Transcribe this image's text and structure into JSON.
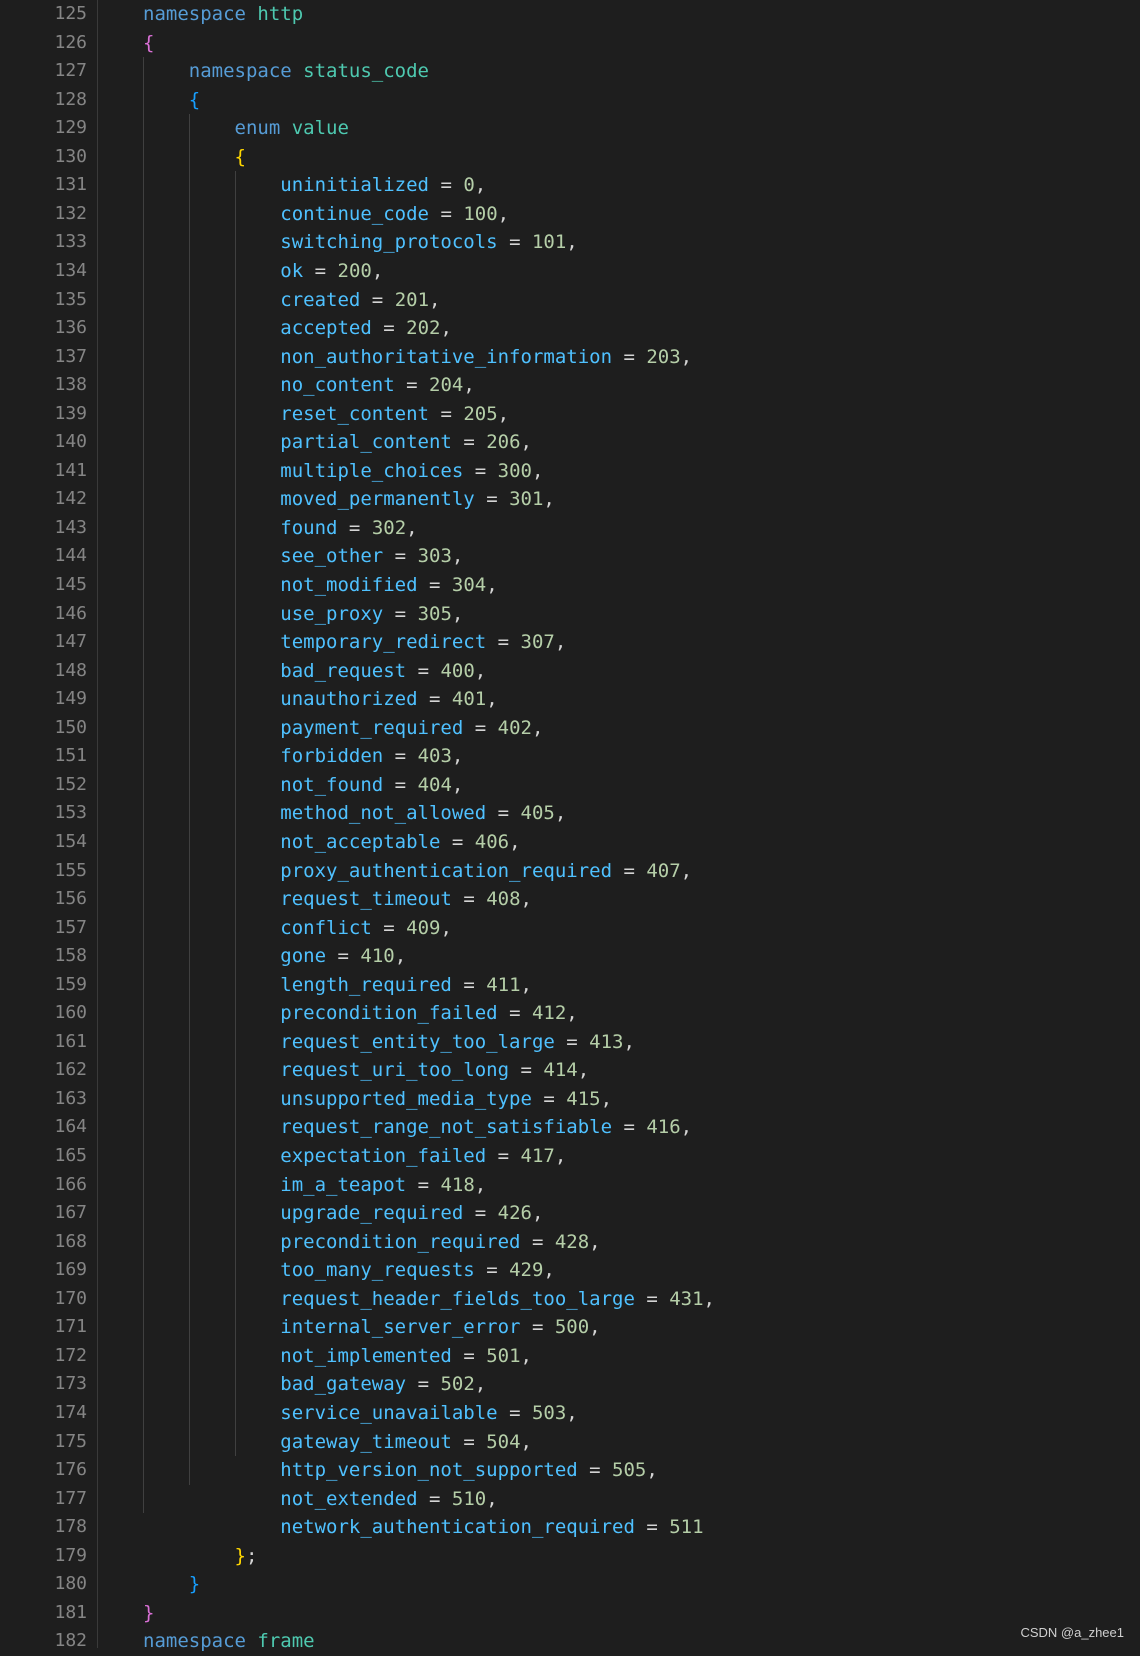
{
  "editor": {
    "first_line_number": 125,
    "lines": [
      [
        [
          "keyword",
          "namespace"
        ],
        [
          "punc",
          " "
        ],
        [
          "ns",
          "http"
        ]
      ],
      [
        [
          "brace-1",
          "{"
        ]
      ],
      [
        [
          "punc",
          "    "
        ],
        [
          "keyword",
          "namespace"
        ],
        [
          "punc",
          " "
        ],
        [
          "ns",
          "status_code"
        ]
      ],
      [
        [
          "punc",
          "    "
        ],
        [
          "brace-2",
          "{"
        ]
      ],
      [
        [
          "punc",
          "        "
        ],
        [
          "keyword",
          "enum"
        ],
        [
          "punc",
          " "
        ],
        [
          "ns",
          "value"
        ]
      ],
      [
        [
          "punc",
          "        "
        ],
        [
          "brace-3",
          "{"
        ]
      ],
      [
        [
          "punc",
          "            "
        ],
        [
          "member",
          "uninitialized"
        ],
        [
          "punc",
          " = "
        ],
        [
          "num",
          "0"
        ],
        [
          "punc",
          ","
        ]
      ],
      [
        [
          "punc",
          "            "
        ],
        [
          "member",
          "continue_code"
        ],
        [
          "punc",
          " = "
        ],
        [
          "num",
          "100"
        ],
        [
          "punc",
          ","
        ]
      ],
      [
        [
          "punc",
          "            "
        ],
        [
          "member",
          "switching_protocols"
        ],
        [
          "punc",
          " = "
        ],
        [
          "num",
          "101"
        ],
        [
          "punc",
          ","
        ]
      ],
      [
        [
          "punc",
          "            "
        ],
        [
          "member",
          "ok"
        ],
        [
          "punc",
          " = "
        ],
        [
          "num",
          "200"
        ],
        [
          "punc",
          ","
        ]
      ],
      [
        [
          "punc",
          "            "
        ],
        [
          "member",
          "created"
        ],
        [
          "punc",
          " = "
        ],
        [
          "num",
          "201"
        ],
        [
          "punc",
          ","
        ]
      ],
      [
        [
          "punc",
          "            "
        ],
        [
          "member",
          "accepted"
        ],
        [
          "punc",
          " = "
        ],
        [
          "num",
          "202"
        ],
        [
          "punc",
          ","
        ]
      ],
      [
        [
          "punc",
          "            "
        ],
        [
          "member",
          "non_authoritative_information"
        ],
        [
          "punc",
          " = "
        ],
        [
          "num",
          "203"
        ],
        [
          "punc",
          ","
        ]
      ],
      [
        [
          "punc",
          "            "
        ],
        [
          "member",
          "no_content"
        ],
        [
          "punc",
          " = "
        ],
        [
          "num",
          "204"
        ],
        [
          "punc",
          ","
        ]
      ],
      [
        [
          "punc",
          "            "
        ],
        [
          "member",
          "reset_content"
        ],
        [
          "punc",
          " = "
        ],
        [
          "num",
          "205"
        ],
        [
          "punc",
          ","
        ]
      ],
      [
        [
          "punc",
          "            "
        ],
        [
          "member",
          "partial_content"
        ],
        [
          "punc",
          " = "
        ],
        [
          "num",
          "206"
        ],
        [
          "punc",
          ","
        ]
      ],
      [
        [
          "punc",
          "            "
        ],
        [
          "member",
          "multiple_choices"
        ],
        [
          "punc",
          " = "
        ],
        [
          "num",
          "300"
        ],
        [
          "punc",
          ","
        ]
      ],
      [
        [
          "punc",
          "            "
        ],
        [
          "member",
          "moved_permanently"
        ],
        [
          "punc",
          " = "
        ],
        [
          "num",
          "301"
        ],
        [
          "punc",
          ","
        ]
      ],
      [
        [
          "punc",
          "            "
        ],
        [
          "member",
          "found"
        ],
        [
          "punc",
          " = "
        ],
        [
          "num",
          "302"
        ],
        [
          "punc",
          ","
        ]
      ],
      [
        [
          "punc",
          "            "
        ],
        [
          "member",
          "see_other"
        ],
        [
          "punc",
          " = "
        ],
        [
          "num",
          "303"
        ],
        [
          "punc",
          ","
        ]
      ],
      [
        [
          "punc",
          "            "
        ],
        [
          "member",
          "not_modified"
        ],
        [
          "punc",
          " = "
        ],
        [
          "num",
          "304"
        ],
        [
          "punc",
          ","
        ]
      ],
      [
        [
          "punc",
          "            "
        ],
        [
          "member",
          "use_proxy"
        ],
        [
          "punc",
          " = "
        ],
        [
          "num",
          "305"
        ],
        [
          "punc",
          ","
        ]
      ],
      [
        [
          "punc",
          "            "
        ],
        [
          "member",
          "temporary_redirect"
        ],
        [
          "punc",
          " = "
        ],
        [
          "num",
          "307"
        ],
        [
          "punc",
          ","
        ]
      ],
      [
        [
          "punc",
          "            "
        ],
        [
          "member",
          "bad_request"
        ],
        [
          "punc",
          " = "
        ],
        [
          "num",
          "400"
        ],
        [
          "punc",
          ","
        ]
      ],
      [
        [
          "punc",
          "            "
        ],
        [
          "member",
          "unauthorized"
        ],
        [
          "punc",
          " = "
        ],
        [
          "num",
          "401"
        ],
        [
          "punc",
          ","
        ]
      ],
      [
        [
          "punc",
          "            "
        ],
        [
          "member",
          "payment_required"
        ],
        [
          "punc",
          " = "
        ],
        [
          "num",
          "402"
        ],
        [
          "punc",
          ","
        ]
      ],
      [
        [
          "punc",
          "            "
        ],
        [
          "member",
          "forbidden"
        ],
        [
          "punc",
          " = "
        ],
        [
          "num",
          "403"
        ],
        [
          "punc",
          ","
        ]
      ],
      [
        [
          "punc",
          "            "
        ],
        [
          "member",
          "not_found"
        ],
        [
          "punc",
          " = "
        ],
        [
          "num",
          "404"
        ],
        [
          "punc",
          ","
        ]
      ],
      [
        [
          "punc",
          "            "
        ],
        [
          "member",
          "method_not_allowed"
        ],
        [
          "punc",
          " = "
        ],
        [
          "num",
          "405"
        ],
        [
          "punc",
          ","
        ]
      ],
      [
        [
          "punc",
          "            "
        ],
        [
          "member",
          "not_acceptable"
        ],
        [
          "punc",
          " = "
        ],
        [
          "num",
          "406"
        ],
        [
          "punc",
          ","
        ]
      ],
      [
        [
          "punc",
          "            "
        ],
        [
          "member",
          "proxy_authentication_required"
        ],
        [
          "punc",
          " = "
        ],
        [
          "num",
          "407"
        ],
        [
          "punc",
          ","
        ]
      ],
      [
        [
          "punc",
          "            "
        ],
        [
          "member",
          "request_timeout"
        ],
        [
          "punc",
          " = "
        ],
        [
          "num",
          "408"
        ],
        [
          "punc",
          ","
        ]
      ],
      [
        [
          "punc",
          "            "
        ],
        [
          "member",
          "conflict"
        ],
        [
          "punc",
          " = "
        ],
        [
          "num",
          "409"
        ],
        [
          "punc",
          ","
        ]
      ],
      [
        [
          "punc",
          "            "
        ],
        [
          "member",
          "gone"
        ],
        [
          "punc",
          " = "
        ],
        [
          "num",
          "410"
        ],
        [
          "punc",
          ","
        ]
      ],
      [
        [
          "punc",
          "            "
        ],
        [
          "member",
          "length_required"
        ],
        [
          "punc",
          " = "
        ],
        [
          "num",
          "411"
        ],
        [
          "punc",
          ","
        ]
      ],
      [
        [
          "punc",
          "            "
        ],
        [
          "member",
          "precondition_failed"
        ],
        [
          "punc",
          " = "
        ],
        [
          "num",
          "412"
        ],
        [
          "punc",
          ","
        ]
      ],
      [
        [
          "punc",
          "            "
        ],
        [
          "member",
          "request_entity_too_large"
        ],
        [
          "punc",
          " = "
        ],
        [
          "num",
          "413"
        ],
        [
          "punc",
          ","
        ]
      ],
      [
        [
          "punc",
          "            "
        ],
        [
          "member",
          "request_uri_too_long"
        ],
        [
          "punc",
          " = "
        ],
        [
          "num",
          "414"
        ],
        [
          "punc",
          ","
        ]
      ],
      [
        [
          "punc",
          "            "
        ],
        [
          "member",
          "unsupported_media_type"
        ],
        [
          "punc",
          " = "
        ],
        [
          "num",
          "415"
        ],
        [
          "punc",
          ","
        ]
      ],
      [
        [
          "punc",
          "            "
        ],
        [
          "member",
          "request_range_not_satisfiable"
        ],
        [
          "punc",
          " = "
        ],
        [
          "num",
          "416"
        ],
        [
          "punc",
          ","
        ]
      ],
      [
        [
          "punc",
          "            "
        ],
        [
          "member",
          "expectation_failed"
        ],
        [
          "punc",
          " = "
        ],
        [
          "num",
          "417"
        ],
        [
          "punc",
          ","
        ]
      ],
      [
        [
          "punc",
          "            "
        ],
        [
          "member",
          "im_a_teapot"
        ],
        [
          "punc",
          " = "
        ],
        [
          "num",
          "418"
        ],
        [
          "punc",
          ","
        ]
      ],
      [
        [
          "punc",
          "            "
        ],
        [
          "member",
          "upgrade_required"
        ],
        [
          "punc",
          " = "
        ],
        [
          "num",
          "426"
        ],
        [
          "punc",
          ","
        ]
      ],
      [
        [
          "punc",
          "            "
        ],
        [
          "member",
          "precondition_required"
        ],
        [
          "punc",
          " = "
        ],
        [
          "num",
          "428"
        ],
        [
          "punc",
          ","
        ]
      ],
      [
        [
          "punc",
          "            "
        ],
        [
          "member",
          "too_many_requests"
        ],
        [
          "punc",
          " = "
        ],
        [
          "num",
          "429"
        ],
        [
          "punc",
          ","
        ]
      ],
      [
        [
          "punc",
          "            "
        ],
        [
          "member",
          "request_header_fields_too_large"
        ],
        [
          "punc",
          " = "
        ],
        [
          "num",
          "431"
        ],
        [
          "punc",
          ","
        ]
      ],
      [
        [
          "punc",
          "            "
        ],
        [
          "member",
          "internal_server_error"
        ],
        [
          "punc",
          " = "
        ],
        [
          "num",
          "500"
        ],
        [
          "punc",
          ","
        ]
      ],
      [
        [
          "punc",
          "            "
        ],
        [
          "member",
          "not_implemented"
        ],
        [
          "punc",
          " = "
        ],
        [
          "num",
          "501"
        ],
        [
          "punc",
          ","
        ]
      ],
      [
        [
          "punc",
          "            "
        ],
        [
          "member",
          "bad_gateway"
        ],
        [
          "punc",
          " = "
        ],
        [
          "num",
          "502"
        ],
        [
          "punc",
          ","
        ]
      ],
      [
        [
          "punc",
          "            "
        ],
        [
          "member",
          "service_unavailable"
        ],
        [
          "punc",
          " = "
        ],
        [
          "num",
          "503"
        ],
        [
          "punc",
          ","
        ]
      ],
      [
        [
          "punc",
          "            "
        ],
        [
          "member",
          "gateway_timeout"
        ],
        [
          "punc",
          " = "
        ],
        [
          "num",
          "504"
        ],
        [
          "punc",
          ","
        ]
      ],
      [
        [
          "punc",
          "            "
        ],
        [
          "member",
          "http_version_not_supported"
        ],
        [
          "punc",
          " = "
        ],
        [
          "num",
          "505"
        ],
        [
          "punc",
          ","
        ]
      ],
      [
        [
          "punc",
          "            "
        ],
        [
          "member",
          "not_extended"
        ],
        [
          "punc",
          " = "
        ],
        [
          "num",
          "510"
        ],
        [
          "punc",
          ","
        ]
      ],
      [
        [
          "punc",
          "            "
        ],
        [
          "member",
          "network_authentication_required"
        ],
        [
          "punc",
          " = "
        ],
        [
          "num",
          "511"
        ]
      ],
      [
        [
          "punc",
          "        "
        ],
        [
          "brace-3",
          "}"
        ],
        [
          "punc",
          ";"
        ]
      ],
      [
        [
          "punc",
          "    "
        ],
        [
          "brace-2",
          "}"
        ]
      ],
      [
        [
          "brace-1",
          "}"
        ]
      ],
      [
        [
          "keyword",
          "namespace"
        ],
        [
          "punc",
          " "
        ],
        [
          "ns",
          "frame"
        ]
      ]
    ]
  },
  "colors": {
    "background": "#1e1e1e",
    "line_number": "#858585",
    "keyword": "#569cd6",
    "namespace": "#4ec9b0",
    "enum_member": "#4fc1ff",
    "number": "#b5cea8",
    "brace_level_1": "#da70d6",
    "brace_level_2": "#179fff",
    "brace_level_3": "#ffd700"
  },
  "watermark": "CSDN @a_zhee1"
}
